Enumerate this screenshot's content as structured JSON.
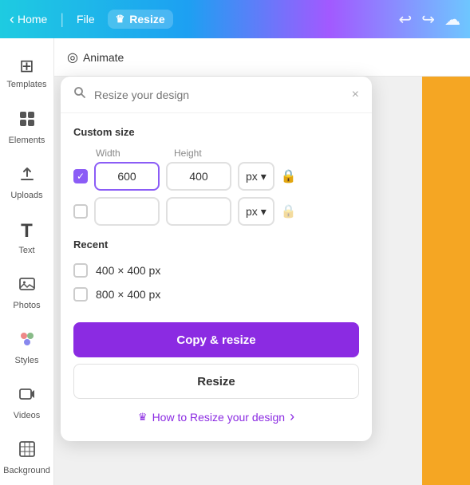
{
  "topbar": {
    "home_label": "Home",
    "file_label": "File",
    "resize_label": "Resize",
    "crown_icon": "♛",
    "back_icon": "‹",
    "undo_icon": "↩",
    "redo_icon": "↪",
    "cloud_icon": "☁"
  },
  "sidebar": {
    "items": [
      {
        "id": "templates",
        "label": "Templates",
        "icon": "⊞"
      },
      {
        "id": "elements",
        "label": "Elements",
        "icon": "❖"
      },
      {
        "id": "uploads",
        "label": "Uploads",
        "icon": "⬆"
      },
      {
        "id": "text",
        "label": "Text",
        "icon": "T"
      },
      {
        "id": "photos",
        "label": "Photos",
        "icon": "🖼"
      },
      {
        "id": "styles",
        "label": "Styles",
        "icon": "🎨"
      },
      {
        "id": "videos",
        "label": "Videos",
        "icon": "▶"
      },
      {
        "id": "background",
        "label": "Background",
        "icon": "▦"
      }
    ]
  },
  "tab": {
    "animate_label": "Animate",
    "circle_icon": "◎"
  },
  "search": {
    "placeholder": "Resize your design",
    "close_icon": "×"
  },
  "panel": {
    "custom_size_label": "Custom size",
    "width_label": "Width",
    "height_label": "Height",
    "row1": {
      "checked": true,
      "width_value": "600",
      "height_value": "400",
      "unit": "px"
    },
    "row2": {
      "checked": false,
      "width_value": "",
      "height_value": "",
      "unit": "px"
    },
    "recent_label": "Recent",
    "recent_items": [
      {
        "label": "400 × 400 px"
      },
      {
        "label": "800 × 400 px"
      }
    ],
    "copy_resize_label": "Copy & resize",
    "resize_label": "Resize",
    "how_to_label": "How to Resize your design",
    "how_to_arrow": "›",
    "crown_icon": "♛"
  }
}
